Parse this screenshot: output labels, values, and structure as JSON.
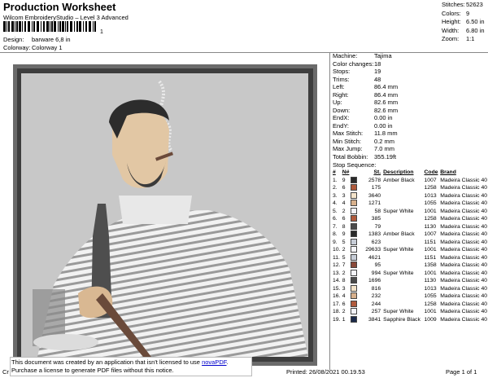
{
  "header": {
    "title": "Production Worksheet",
    "subtitle": "Wilcom EmbroideryStudio – Level 3 Advanced",
    "barcode_mark": "1"
  },
  "summary": [
    {
      "label": "Stitches:",
      "value": "52623"
    },
    {
      "label": "Colors:",
      "value": "9"
    },
    {
      "label": "Height:",
      "value": "6.50 in"
    },
    {
      "label": "Width:",
      "value": "6.80 in"
    },
    {
      "label": "Zoom:",
      "value": "1:1"
    }
  ],
  "design": [
    {
      "label": "Design:",
      "value": "barware 6,8 in"
    },
    {
      "label": "Colorway:",
      "value": "Colorway 1"
    }
  ],
  "machine": [
    {
      "label": "Machine:",
      "value": "Tajima"
    },
    {
      "label": "Color changes:",
      "value": "18"
    },
    {
      "label": "Stops:",
      "value": "19"
    },
    {
      "label": "Trims:",
      "value": "48"
    },
    {
      "label": "Left:",
      "value": "86.4 mm"
    },
    {
      "label": "Right:",
      "value": "86.4 mm"
    },
    {
      "label": "Up:",
      "value": "82.6 mm"
    },
    {
      "label": "Down:",
      "value": "82.6 mm"
    },
    {
      "label": "EndX:",
      "value": "0.00 in"
    },
    {
      "label": "EndY:",
      "value": "0.00 in"
    },
    {
      "label": "Max Stitch:",
      "value": "11.8 mm"
    },
    {
      "label": "Min Stitch:",
      "value": "0.2 mm"
    },
    {
      "label": "Max Jump:",
      "value": "7.0 mm"
    },
    {
      "label": "Total Bobbin:",
      "value": "355.19ft"
    }
  ],
  "stop_sequence": {
    "label": "Stop Sequence:",
    "columns": [
      "#",
      "N#",
      "",
      "St.",
      "Description",
      "Code",
      "Brand"
    ],
    "rows": [
      {
        "n": "1.",
        "nn": "9",
        "color": "#2a2a2a",
        "st": "2578",
        "desc": "Amber Black",
        "code": "1007",
        "brand": "Madeira Classic 40"
      },
      {
        "n": "2.",
        "nn": "6",
        "color": "#b05a3c",
        "st": "175",
        "desc": "",
        "code": "1258",
        "brand": "Madeira Classic 40"
      },
      {
        "n": "3.",
        "nn": "3",
        "color": "#f3e3c9",
        "st": "3640",
        "desc": "",
        "code": "1013",
        "brand": "Madeira Classic 40"
      },
      {
        "n": "4.",
        "nn": "4",
        "color": "#d7b08c",
        "st": "1271",
        "desc": "",
        "code": "1055",
        "brand": "Madeira Classic 40"
      },
      {
        "n": "5.",
        "nn": "2",
        "color": "#f4f4f8",
        "st": "58",
        "desc": "Super White",
        "code": "1001",
        "brand": "Madeira Classic 40"
      },
      {
        "n": "6.",
        "nn": "6",
        "color": "#b05a3c",
        "st": "385",
        "desc": "",
        "code": "1258",
        "brand": "Madeira Classic 40"
      },
      {
        "n": "7.",
        "nn": "8",
        "color": "#4a4a4a",
        "st": "79",
        "desc": "",
        "code": "1130",
        "brand": "Madeira Classic 40"
      },
      {
        "n": "8.",
        "nn": "9",
        "color": "#2a2a2a",
        "st": "1383",
        "desc": "Amber Black",
        "code": "1007",
        "brand": "Madeira Classic 40"
      },
      {
        "n": "9.",
        "nn": "5",
        "color": "#c6ccd6",
        "st": "623",
        "desc": "",
        "code": "1151",
        "brand": "Madeira Classic 40"
      },
      {
        "n": "10.",
        "nn": "2",
        "color": "#f4f4f8",
        "st": "29633",
        "desc": "Super White",
        "code": "1001",
        "brand": "Madeira Classic 40"
      },
      {
        "n": "11.",
        "nn": "5",
        "color": "#c6ccd6",
        "st": "4621",
        "desc": "",
        "code": "1151",
        "brand": "Madeira Classic 40"
      },
      {
        "n": "12.",
        "nn": "7",
        "color": "#8a4a3a",
        "st": "95",
        "desc": "",
        "code": "1358",
        "brand": "Madeira Classic 40"
      },
      {
        "n": "13.",
        "nn": "2",
        "color": "#f4f4f8",
        "st": "994",
        "desc": "Super White",
        "code": "1001",
        "brand": "Madeira Classic 40"
      },
      {
        "n": "14.",
        "nn": "8",
        "color": "#4a4a4a",
        "st": "1696",
        "desc": "",
        "code": "1130",
        "brand": "Madeira Classic 40"
      },
      {
        "n": "15.",
        "nn": "3",
        "color": "#f3e3c9",
        "st": "816",
        "desc": "",
        "code": "1013",
        "brand": "Madeira Classic 40"
      },
      {
        "n": "16.",
        "nn": "4",
        "color": "#d7b08c",
        "st": "232",
        "desc": "",
        "code": "1055",
        "brand": "Madeira Classic 40"
      },
      {
        "n": "17.",
        "nn": "6",
        "color": "#b05a3c",
        "st": "244",
        "desc": "",
        "code": "1258",
        "brand": "Madeira Classic 40"
      },
      {
        "n": "18.",
        "nn": "2",
        "color": "#f4f4f8",
        "st": "257",
        "desc": "Super White",
        "code": "1001",
        "brand": "Madeira Classic 40"
      },
      {
        "n": "19.",
        "nn": "1",
        "color": "#1c2a4a",
        "st": "3841",
        "desc": "Sapphire Black",
        "code": "1009",
        "brand": "Madeira Classic 40"
      }
    ]
  },
  "footer": {
    "notice_prefix": "This document was created by an application that isn't licensed to use ",
    "notice_link": "novaPDF",
    "notice_suffix": ".",
    "notice_line2": "Purchase a license to generate PDF files without this notice.",
    "cr": "Cr",
    "printed": "Printed: 26/08/2021 00.19.53",
    "page": "Page 1 of 1"
  }
}
